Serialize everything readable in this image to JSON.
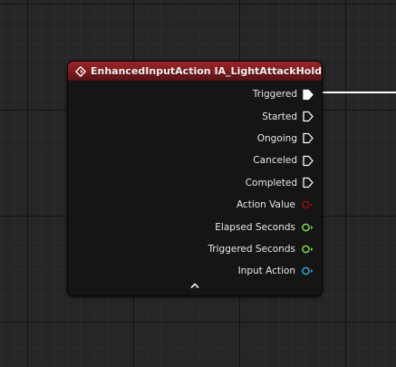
{
  "node": {
    "title": "EnhancedInputAction IA_LightAttackHold",
    "header_icon": "event-diamond-icon",
    "colors": {
      "header": "#8c1f22",
      "body": "#141514",
      "exec_pin": "#ffffff",
      "value_pin": "#8b1212",
      "float_pin": "#79d84a",
      "object_pin": "#2aa3d6",
      "wire": "#ffffff"
    },
    "pins": [
      {
        "label": "Triggered",
        "kind": "exec",
        "connected": true,
        "icon": "exec-pin-icon"
      },
      {
        "label": "Started",
        "kind": "exec",
        "connected": false,
        "icon": "exec-pin-icon"
      },
      {
        "label": "Ongoing",
        "kind": "exec",
        "connected": false,
        "icon": "exec-pin-icon"
      },
      {
        "label": "Canceled",
        "kind": "exec",
        "connected": false,
        "icon": "exec-pin-icon"
      },
      {
        "label": "Completed",
        "kind": "exec",
        "connected": false,
        "icon": "exec-pin-icon"
      },
      {
        "label": "Action Value",
        "kind": "value",
        "connected": false,
        "icon": "data-pin-icon"
      },
      {
        "label": "Elapsed Seconds",
        "kind": "float",
        "connected": false,
        "icon": "data-pin-icon"
      },
      {
        "label": "Triggered Seconds",
        "kind": "float",
        "connected": false,
        "icon": "data-pin-icon"
      },
      {
        "label": "Input Action",
        "kind": "object",
        "connected": false,
        "icon": "data-pin-icon"
      }
    ],
    "collapse_icon": "chevron-up-icon"
  }
}
